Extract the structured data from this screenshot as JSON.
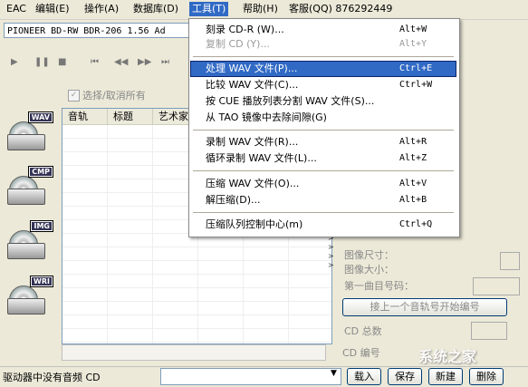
{
  "menubar": {
    "items": [
      "EAC",
      "编辑(E)",
      "操作(A)",
      "数据库(D)",
      "工具(T)",
      "帮助(H)",
      "客服(QQ) 876292449"
    ]
  },
  "drive": {
    "label": "PIONEER BD-RW  BDR-206 1.56  Ad"
  },
  "transport": [
    "▶",
    "❚❚",
    "■",
    "⏮",
    "◀◀",
    "▶▶",
    "⏭"
  ],
  "select_all": "选择/取消所有",
  "side_icons": [
    "WAV",
    "CMP",
    "IMG",
    "WRI"
  ],
  "tracklist": {
    "columns": [
      "音轨",
      "标题",
      "艺术家"
    ]
  },
  "right_panel": {
    "image_size": "图像尺寸：",
    "image_size2": "图像大小：",
    "first_track": "第一曲目号码：",
    "first_track_btn": "接上一个音轨号开始编号",
    "cd_total": "CD 总数",
    "cd_number": "CD 编号"
  },
  "status": {
    "text": "驱动器中没有音频 CD",
    "buttons": [
      "载入",
      "保存",
      "新建",
      "删除"
    ]
  },
  "tools_menu": {
    "items": [
      {
        "label": "刻录 CD-R (W)...",
        "shortcut": "Alt+W",
        "disabled": false,
        "highlight": false
      },
      {
        "label": "复制 CD (Y)...",
        "shortcut": "Alt+Y",
        "disabled": true,
        "highlight": false
      },
      {
        "label": "处理 WAV 文件(P)...",
        "shortcut": "Ctrl+E",
        "disabled": false,
        "highlight": true
      },
      {
        "label": "比较 WAV 文件(C)...",
        "shortcut": "Ctrl+W",
        "disabled": false,
        "highlight": false
      },
      {
        "label": "按 CUE 播放列表分割 WAV 文件(S)...",
        "shortcut": "",
        "disabled": false,
        "highlight": false
      },
      {
        "label": "从 TAO 镜像中去除间隙(G)",
        "shortcut": "",
        "disabled": false,
        "highlight": false
      },
      {
        "label": "录制 WAV 文件(R)...",
        "shortcut": "Alt+R",
        "disabled": false,
        "highlight": false
      },
      {
        "label": "循环录制 WAV 文件(L)...",
        "shortcut": "Alt+Z",
        "disabled": false,
        "highlight": false
      },
      {
        "label": "压缩 WAV 文件(O)...",
        "shortcut": "Alt+V",
        "disabled": false,
        "highlight": false
      },
      {
        "label": "解压缩(D)...",
        "shortcut": "Alt+B",
        "disabled": false,
        "highlight": false
      },
      {
        "label": "压缩队列控制中心(m)",
        "shortcut": "Ctrl+Q",
        "disabled": false,
        "highlight": false
      }
    ]
  },
  "watermark": "系统之家",
  "colors": {
    "highlight": "#316ac5",
    "face": "#ece9d8"
  }
}
